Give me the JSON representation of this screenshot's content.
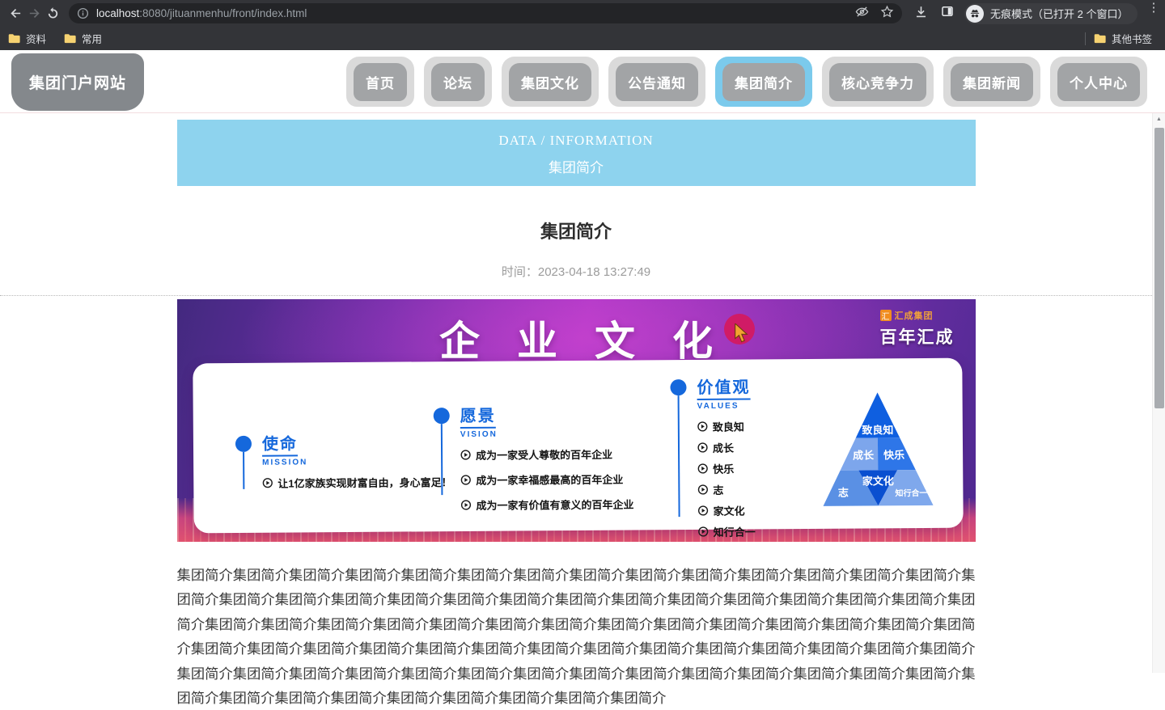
{
  "colors": {
    "accent_blue": "#1568dc",
    "banner_blue": "#8ed3ee",
    "active_tab_blue": "#7bcaec",
    "tab_gray": "#a2a4a6",
    "hero_magenta": "#a336c4",
    "cursor_red": "#d5195e"
  },
  "browser": {
    "url_host": "localhost",
    "url_rest": ":8080/jituanmenhu/front/index.html",
    "incognito_label": "无痕模式（已打开 2 个窗口）",
    "bookmarks": [
      {
        "label": "资料"
      },
      {
        "label": "常用"
      }
    ],
    "other_bookmarks_label": "其他书签"
  },
  "site": {
    "logo": "集团门户网站",
    "nav": [
      {
        "label": "首页"
      },
      {
        "label": "论坛"
      },
      {
        "label": "集团文化"
      },
      {
        "label": "公告通知"
      },
      {
        "label": "集团简介"
      },
      {
        "label": "核心竞争力"
      },
      {
        "label": "集团新闻"
      },
      {
        "label": "个人中心"
      }
    ]
  },
  "info_banner": {
    "eyebrow": "DATA / INFORMATION",
    "title": "集团简介"
  },
  "article": {
    "title": "集团简介",
    "time_label": "时间：",
    "time_value": "2023-04-18 13:27:49",
    "body": "集团简介集团简介集团简介集团简介集团简介集团简介集团简介集团简介集团简介集团简介集团简介集团简介集团简介集团简介集团简介集团简介集团简介集团简介集团简介集团简介集团简介集团简介集团简介集团简介集团简介集团简介集团简介集团简介集团简介集团简介集团简介集团简介集团简介集团简介集团简介集团简介集团简介集团简介集团简介集团简介集团简介集团简介集团简介集团简介集团简介集团简介集团简介集团简介集团简介集团简介集团简介集团简介集团简介集团简介集团简介集团简介集团简介集团简介集团简介集团简介集团简介集团简介集团简介集团简介集团简介集团简介集团简介集团简介集团简介集团简介集团简介集团简介集团简介集团简介集团简介集团简介集团简介集团简介集团简介集团简介"
  },
  "hero": {
    "title": "企业文化",
    "brand": {
      "logo_char": "汇",
      "name": "汇成集团",
      "slogan": "百年汇成"
    },
    "mission": {
      "title": "使命",
      "subtitle": "MISSION",
      "items": [
        "让1亿家族实现财富自由，身心富足！"
      ]
    },
    "vision": {
      "title": "愿景",
      "subtitle": "VISION",
      "items": [
        "成为一家受人尊敬的百年企业",
        "成为一家幸福感最高的百年企业",
        "成为一家有价值有意义的百年企业"
      ]
    },
    "values": {
      "title": "价值观",
      "subtitle": "VALUES",
      "items": [
        "致良知",
        "成长",
        "快乐",
        "志",
        "家文化",
        "知行合一"
      ]
    },
    "pyramid": {
      "top": "致良知",
      "mid_left": "成长",
      "mid_right": "快乐",
      "bottom_left": "志",
      "bottom_center": "家文化",
      "bottom_right": "知行合一"
    }
  }
}
